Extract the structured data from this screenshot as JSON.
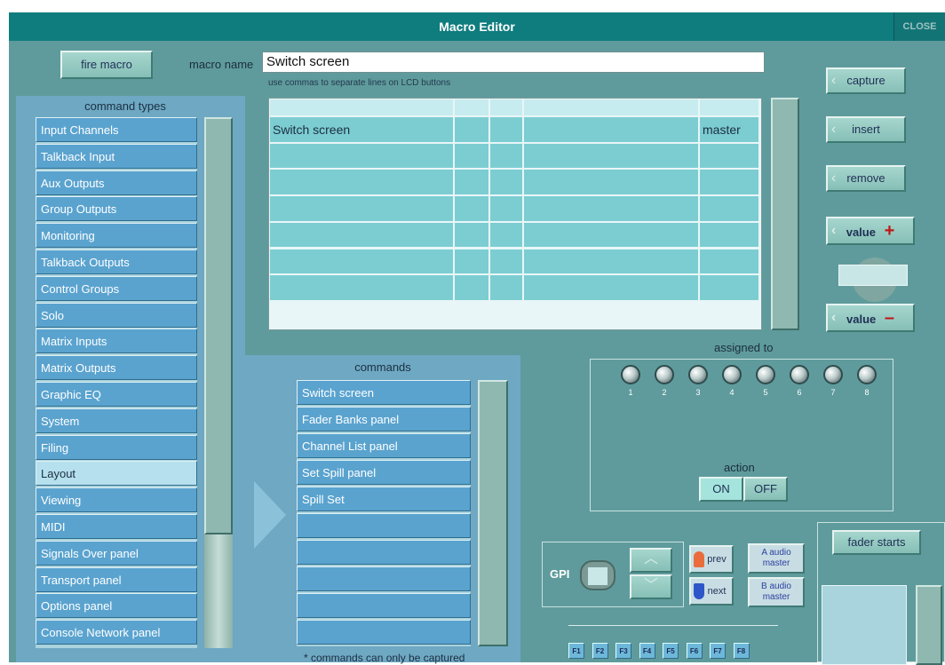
{
  "window": {
    "title": "Macro Editor",
    "close_label": "CLOSE"
  },
  "top": {
    "fire_macro": "fire macro",
    "macro_name_label": "macro name",
    "macro_name_value": "Switch screen",
    "hint": "use commas to separate lines on LCD buttons"
  },
  "right_buttons": {
    "capture": "capture",
    "insert": "insert",
    "remove": "remove",
    "value_plus": "value",
    "value_minus": "value"
  },
  "command_types": {
    "title": "command types",
    "items": [
      "Input Channels",
      "Talkback Input",
      "Aux Outputs",
      "Group Outputs",
      "Monitoring",
      "Talkback Outputs",
      "Control Groups",
      "Solo",
      "Matrix Inputs",
      "Matrix Outputs",
      "Graphic EQ",
      "System",
      "Filing",
      "Layout",
      "Viewing",
      "MIDI",
      "Signals Over panel",
      "Transport panel",
      "Options panel",
      "Console Network panel"
    ],
    "selected_index": 13
  },
  "macro_table": {
    "rows": [
      [
        "",
        "",
        "",
        "",
        ""
      ],
      [
        "Switch screen",
        "",
        "",
        "",
        "master"
      ],
      [
        "",
        "",
        "",
        "",
        ""
      ],
      [
        "",
        "",
        "",
        "",
        ""
      ],
      [
        "",
        "",
        "",
        "",
        ""
      ],
      [
        "",
        "",
        "",
        "",
        ""
      ],
      [
        "",
        "",
        "",
        "",
        ""
      ],
      [
        "",
        "",
        "",
        "",
        ""
      ]
    ]
  },
  "commands": {
    "title": "commands",
    "items": [
      "Switch screen",
      "Fader Banks panel",
      "Channel List panel",
      "Set Spill panel",
      "Spill Set",
      "",
      "",
      "",
      "",
      ""
    ],
    "footnote": "* commands can only be captured"
  },
  "assigned": {
    "title": "assigned to",
    "numbers": [
      "1",
      "2",
      "3",
      "4",
      "5",
      "6",
      "7",
      "8"
    ],
    "action_label": "action",
    "on": "ON",
    "off": "OFF"
  },
  "gpi": {
    "label": "GPI",
    "prev": "prev",
    "next": "next",
    "a_audio_master": "A audio master",
    "b_audio_master": "B audio master"
  },
  "fkeys": [
    "F1",
    "F2",
    "F3",
    "F4",
    "F5",
    "F6",
    "F7",
    "F8"
  ],
  "fader_starts": {
    "label": "fader starts"
  }
}
